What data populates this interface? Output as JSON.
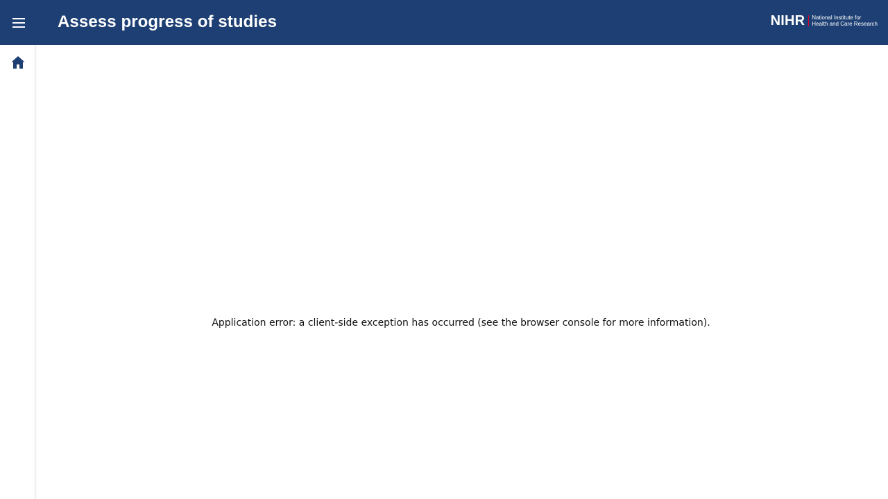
{
  "header": {
    "title": "Assess progress of studies",
    "menu_icon": "menu-icon",
    "background_color": "#1d3f73",
    "logo": {
      "mark": "NIHR",
      "subtitle_line1": "National Institute for",
      "subtitle_line2": "Health and Care Research"
    }
  },
  "sidebar": {
    "items": [
      {
        "icon": "home-icon",
        "label": "Home"
      }
    ]
  },
  "main": {
    "error_message": "Application error: a client-side exception has occurred (see the browser console for more information)."
  }
}
